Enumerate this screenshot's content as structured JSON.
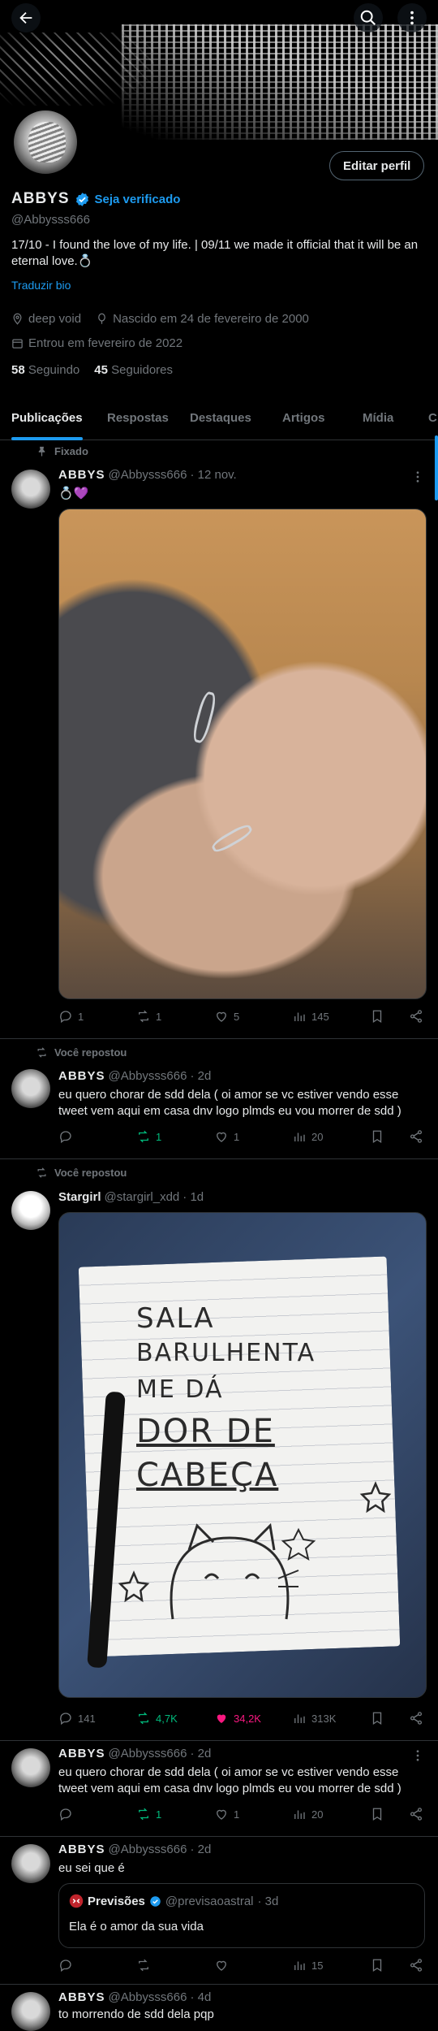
{
  "header": {
    "back_icon": "arrow-left-icon",
    "search_icon": "search-icon",
    "more_icon": "more-vertical-icon"
  },
  "profile": {
    "name": "ABBYS",
    "verify_label": "Seja verificado",
    "handle": "@Abbysss666",
    "edit_label": "Editar perfil",
    "bio": "17/10 - I found the love of my life. | 09/11 we made it official that it will be an eternal love.💍",
    "translate_label": "Traduzir bio",
    "location": "deep void",
    "birth": "Nascido em 24 de fevereiro de 2000",
    "joined": "Entrou em fevereiro de 2022",
    "following_count": "58",
    "following_label": "Seguindo",
    "followers_count": "45",
    "followers_label": "Seguidores"
  },
  "tabs": [
    "Publicações",
    "Respostas",
    "Destaques",
    "Artigos",
    "Mídia",
    "C"
  ],
  "posts": [
    {
      "context": "Fixado",
      "name": "ABBYS",
      "handle": "@Abbysss666",
      "time": "· 12 nov.",
      "text": "💍💜",
      "replies": "1",
      "reposts": "1",
      "likes": "5",
      "views": "145"
    },
    {
      "context": "Você repostou",
      "name": "ABBYS",
      "handle": "@Abbysss666",
      "time": "· 2d",
      "text": "eu quero chorar de sdd dela ( oi amor se vc estiver vendo esse tweet vem aqui em casa dnv logo plmds eu vou morrer de sdd )",
      "replies": "",
      "reposts": "1",
      "likes": "1",
      "views": "20"
    },
    {
      "context": "Você repostou",
      "name": "Stargirl",
      "handle": "@stargirl_xdd",
      "time": "· 1d",
      "note_lines": [
        "SALA",
        "BARULHENTA",
        "ME DÁ",
        "DOR DE",
        "CABEÇA"
      ],
      "replies": "141",
      "reposts": "4,7K",
      "likes": "34,2K",
      "views": "313K"
    },
    {
      "name": "ABBYS",
      "handle": "@Abbysss666",
      "time": "· 2d",
      "text": "eu quero chorar de sdd dela ( oi amor se vc estiver vendo esse tweet vem aqui em casa dnv logo plmds eu vou morrer de sdd )",
      "replies": "",
      "reposts": "1",
      "likes": "1",
      "views": "20"
    },
    {
      "name": "ABBYS",
      "handle": "@Abbysss666",
      "time": "· 2d",
      "text": "eu sei que é",
      "quote": {
        "name": "Previsões",
        "handle": "@previsaoastral",
        "time": "· 3d",
        "text": "Ela é o amor da sua vida"
      },
      "replies": "",
      "reposts": "",
      "likes": "",
      "views": "15"
    },
    {
      "name": "ABBYS",
      "handle": "@Abbysss666",
      "time": "· 4d",
      "text": "to morrendo de sdd dela pqp"
    }
  ],
  "colors": {
    "background": "#000000",
    "accent": "#1d9bf0",
    "repost_green": "#00ba7c",
    "like_pink": "#f91880",
    "muted": "#71767b"
  }
}
